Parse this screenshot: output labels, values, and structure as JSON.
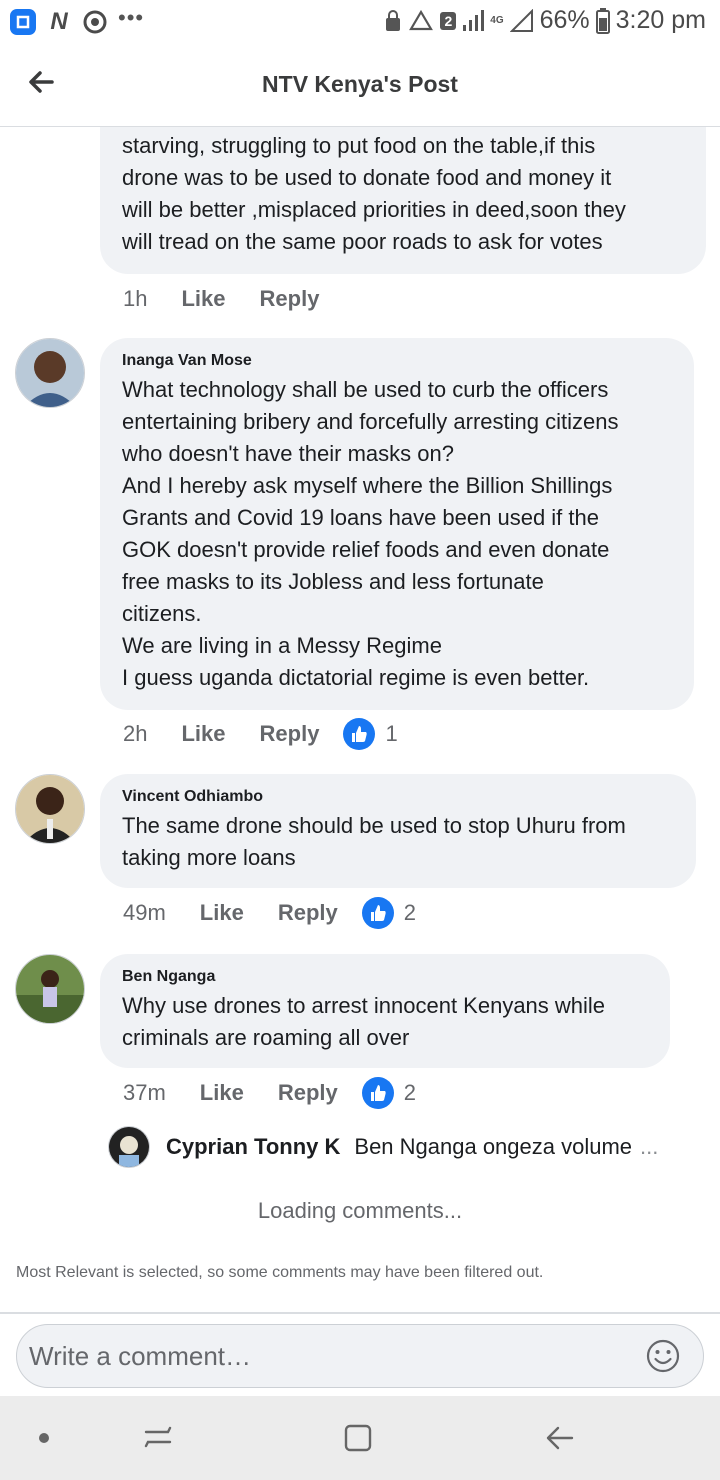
{
  "status_bar": {
    "battery": "66%",
    "time": "3:20 pm",
    "sim_badge": "2",
    "network": "4G"
  },
  "header": {
    "title": "NTV Kenya's Post",
    "back_icon": "arrow-left-icon"
  },
  "comments": [
    {
      "author": "",
      "text": "starving, struggling to put food on the table,if this\ndrone was to be used to donate food and money it\nwill be better ,misplaced priorities in deed,soon they\nwill tread on the same poor roads to ask for votes",
      "time": "1h",
      "like_label": "Like",
      "reply_label": "Reply",
      "reactions": ""
    },
    {
      "author": "Inanga Van Mose",
      "text": "What technology shall be used to curb the officers\nentertaining bribery and forcefully arresting citizens\nwho doesn't have their masks on?\nAnd I hereby ask myself where the Billion Shillings\nGrants and Covid 19 loans have been used if the\nGOK doesn't provide relief foods and even donate\nfree masks to its Jobless and less fortunate\ncitizens.\nWe are living  in a Messy Regime\nI guess uganda dictatorial regime is even better.",
      "time": "2h",
      "like_label": "Like",
      "reply_label": "Reply",
      "reactions": "1"
    },
    {
      "author": "Vincent Odhiambo",
      "text": "The same drone should be used to stop Uhuru from\ntaking more loans",
      "time": "49m",
      "like_label": "Like",
      "reply_label": "Reply",
      "reactions": "2"
    },
    {
      "author": "Ben Nganga",
      "text": "Why use drones to arrest innocent Kenyans while\ncriminals are roaming all over",
      "time": "37m",
      "like_label": "Like",
      "reply_label": "Reply",
      "reactions": "2"
    }
  ],
  "reply_preview": {
    "author": "Cyprian Tonny K",
    "text": "Ben Nganga ongeza volume",
    "more": "..."
  },
  "loading_text": "Loading comments...",
  "filter_note": "Most Relevant is selected, so some comments may have been filtered out.",
  "composer": {
    "placeholder": "Write a comment…"
  },
  "colors": {
    "accent": "#1877f2",
    "bubble": "#f0f2f5",
    "secondary_text": "#65676b"
  }
}
